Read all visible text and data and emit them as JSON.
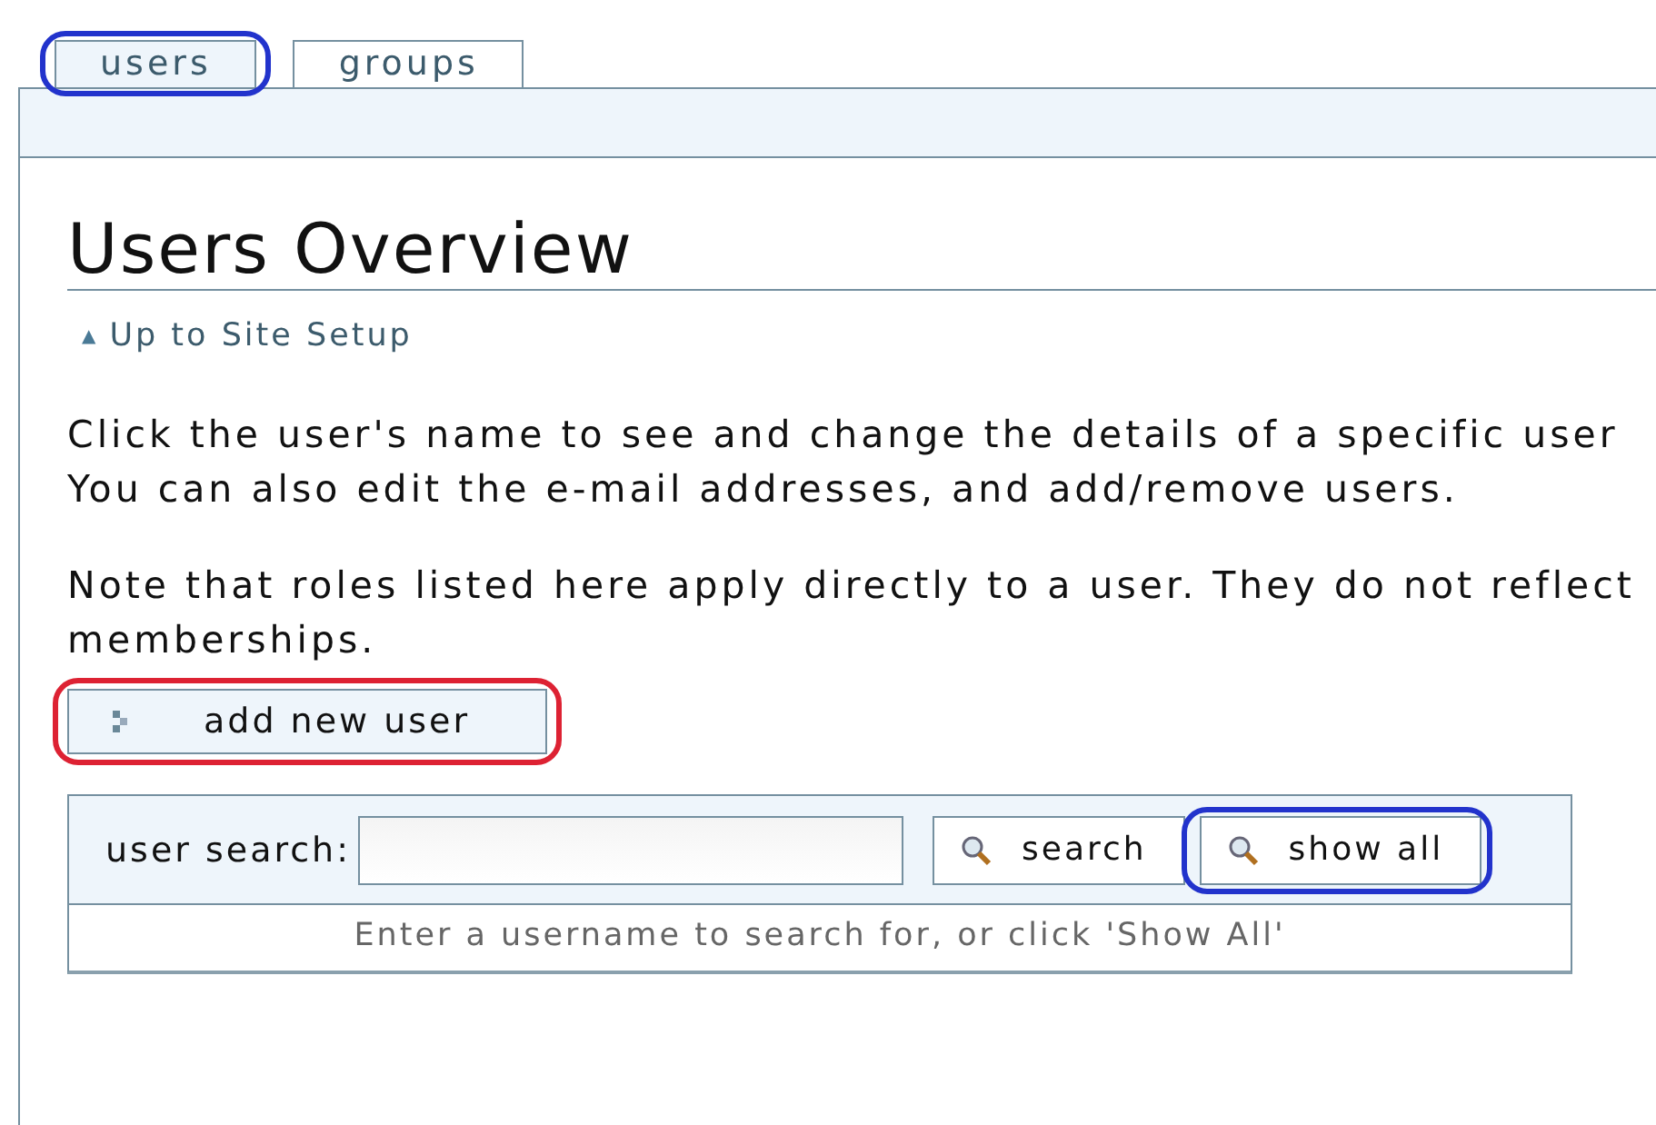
{
  "tabs": [
    {
      "label": "users",
      "selected": true,
      "color": "#2233cc"
    },
    {
      "label": "groups",
      "selected": false
    }
  ],
  "heading": "Users Overview",
  "up_link": {
    "icon": "▲",
    "label": "Up to Site Setup"
  },
  "paragraphs": [
    [
      "Click the user's name to see and change the details of a specific user",
      "You can also edit the e-mail addresses, and add/remove users."
    ],
    [
      "Note that roles listed here apply directly to a user. They do not reflect",
      "memberships."
    ]
  ],
  "add_button": {
    "label": "add new user",
    "color": "#dd2233"
  },
  "search": {
    "label": "user search:",
    "buttons": [
      {
        "label": "search"
      },
      {
        "label": "show all",
        "color": "#2233cc"
      }
    ],
    "hint": "Enter a username to search for, or click 'Show All'"
  }
}
